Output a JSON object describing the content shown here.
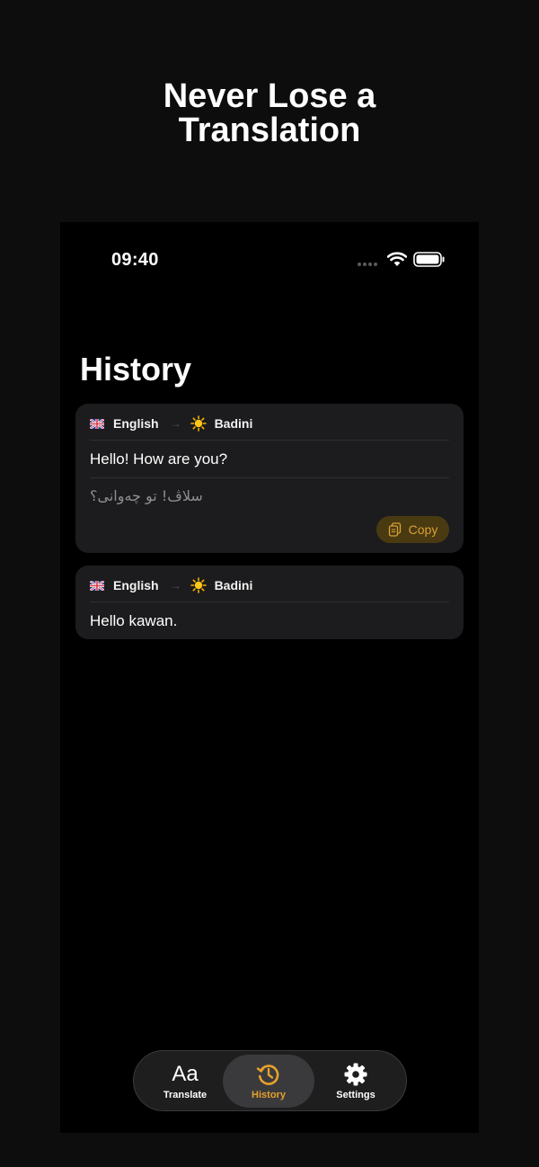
{
  "promo": {
    "line1": "Never Lose a",
    "line2": "Translation"
  },
  "status_bar": {
    "time": "09:40"
  },
  "page": {
    "title": "History"
  },
  "history": [
    {
      "source_lang": "English",
      "target_lang": "Badini",
      "source_text": "Hello! How are you?",
      "target_text": "سلاڤ! تو چەوانی؟",
      "copy_label": "Copy"
    },
    {
      "source_lang": "English",
      "target_lang": "Badini",
      "source_text": "Hello kawan."
    }
  ],
  "tabbar": {
    "items": [
      {
        "label": "Translate",
        "icon": "Aa"
      },
      {
        "label": "History",
        "icon": "history-icon"
      },
      {
        "label": "Settings",
        "icon": "gear-icon"
      }
    ],
    "active_index": 1,
    "accent_color": "#e6a12b"
  }
}
